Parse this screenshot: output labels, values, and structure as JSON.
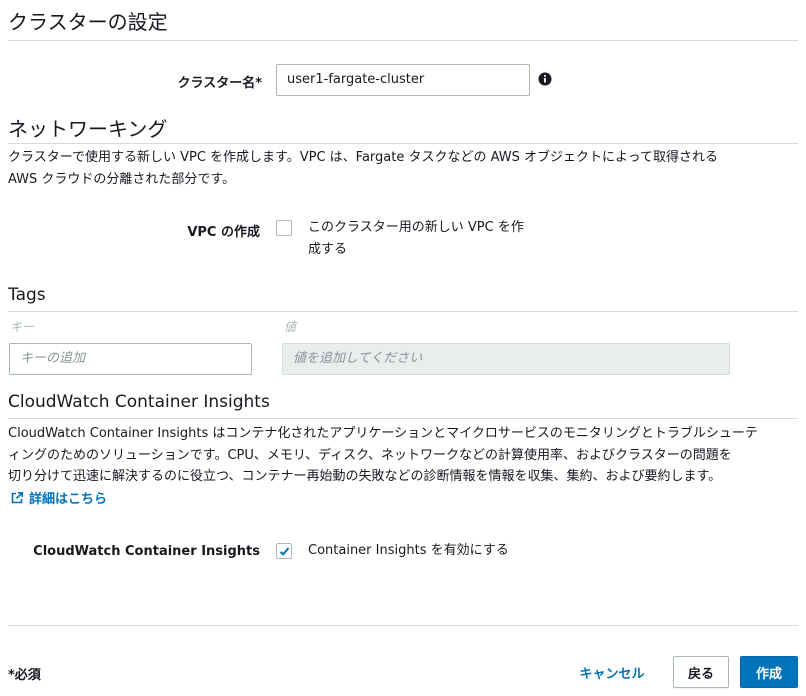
{
  "cluster_settings": {
    "title": "クラスターの設定",
    "name_label": "クラスター名*",
    "name_value": "user1-fargate-cluster",
    "info_icon": "info-icon"
  },
  "networking": {
    "title": "ネットワーキング",
    "description_line1": "クラスターで使用する新しい VPC を作成します。VPC は、Fargate タスクなどの AWS オブジェクトによって取得される",
    "description_line2": "AWS クラウドの分離された部分です。",
    "vpc_label": "VPC の作成",
    "vpc_checkbox_label_line1": "このクラスター用の新しい VPC を作",
    "vpc_checkbox_label_line2": "成する",
    "vpc_checked": false
  },
  "tags": {
    "title": "Tags",
    "key_header": "キー",
    "value_header": "値",
    "key_placeholder": "キーの追加",
    "value_placeholder": "値を追加してください"
  },
  "insights": {
    "title": "CloudWatch Container Insights",
    "description_line1": "CloudWatch Container Insights はコンテナ化されたアプリケーションとマイクロサービスのモニタリングとトラブルシューテ",
    "description_line2": "ィングのためのソリューションです。CPU、メモリ、ディスク、ネットワークなどの計算使用率、およびクラスターの問題を",
    "description_line3": "切り分けて迅速に解決するのに役立つ、コンテナー再始動の失敗などの診断情報を情報を収集、集約、および要約します。",
    "learn_more": "詳細はこちら",
    "toggle_label": "CloudWatch Container Insights",
    "checkbox_label": "Container Insights を有効にする",
    "enabled": true,
    "external_link_icon": "external-link-icon"
  },
  "footer": {
    "required_note": "*必須",
    "cancel": "キャンセル",
    "back": "戻る",
    "create": "作成"
  },
  "colors": {
    "link": "#0073bb",
    "primary_button": "#0073bb",
    "border": "#aab7b8",
    "divider": "#d5dbdb",
    "text": "#16191f"
  }
}
